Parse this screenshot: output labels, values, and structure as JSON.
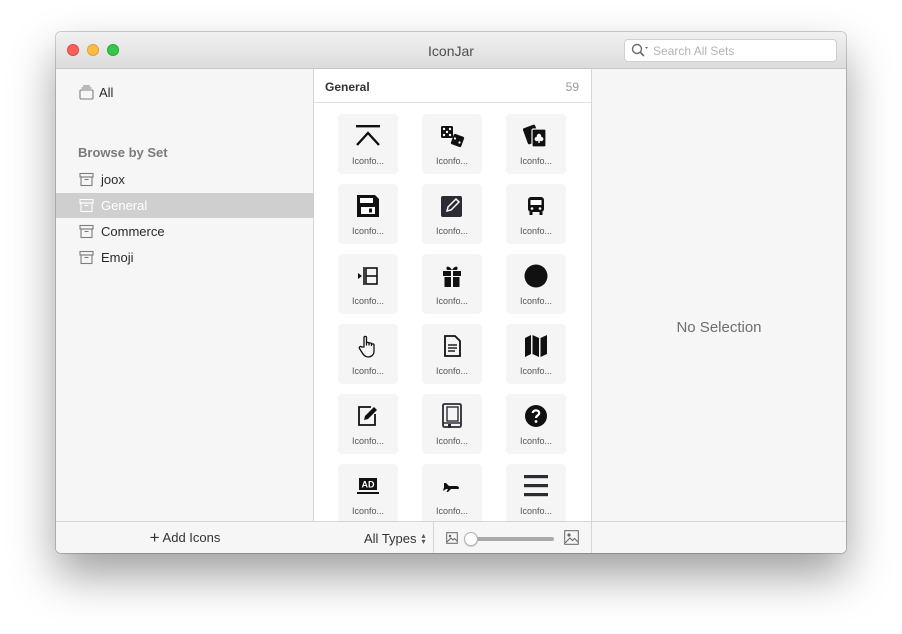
{
  "window": {
    "title": "IconJar"
  },
  "search": {
    "placeholder": "Search All Sets"
  },
  "sidebar": {
    "all_label": "All",
    "section_header": "Browse by Set",
    "sets": [
      {
        "label": "joox",
        "selected": false
      },
      {
        "label": "General",
        "selected": true
      },
      {
        "label": "Commerce",
        "selected": false
      },
      {
        "label": "Emoji",
        "selected": false
      }
    ],
    "add_icons_label": "Add Icons"
  },
  "browser": {
    "set_title": "General",
    "icon_count": "59",
    "icons": [
      {
        "label": "Iconfo...",
        "icon": "to-top-icon"
      },
      {
        "label": "Iconfo...",
        "icon": "dice-icon"
      },
      {
        "label": "Iconfo...",
        "icon": "playing-cards-icon"
      },
      {
        "label": "Iconfo...",
        "icon": "floppy-disk-icon"
      },
      {
        "label": "Iconfo...",
        "icon": "edit-square-icon"
      },
      {
        "label": "Iconfo...",
        "icon": "bus-icon"
      },
      {
        "label": "Iconfo...",
        "icon": "arrow-into-box-icon"
      },
      {
        "label": "Iconfo...",
        "icon": "gift-icon"
      },
      {
        "label": "Iconfo...",
        "icon": "filled-circle-icon"
      },
      {
        "label": "Iconfo...",
        "icon": "hand-pointer-icon"
      },
      {
        "label": "Iconfo...",
        "icon": "document-icon"
      },
      {
        "label": "Iconfo...",
        "icon": "map-icon"
      },
      {
        "label": "Iconfo...",
        "icon": "edit-outline-icon"
      },
      {
        "label": "Iconfo...",
        "icon": "book-icon"
      },
      {
        "label": "Iconfo...",
        "icon": "question-circle-icon"
      },
      {
        "label": "Iconfo...",
        "icon": "ad-screen-icon"
      },
      {
        "label": "Iconfo...",
        "icon": "airplane-landing-icon"
      },
      {
        "label": "Iconfo...",
        "icon": "hamburger-menu-icon"
      }
    ],
    "type_filter": "All Types",
    "size_slider_value": 0.0
  },
  "detail": {
    "empty_text": "No Selection"
  },
  "colors": {
    "selected_row": "#cfcfcf",
    "tile_bg": "#f5f5f5",
    "close": "#fc605b",
    "minimize": "#fdbc40",
    "maximize": "#34c84a"
  }
}
